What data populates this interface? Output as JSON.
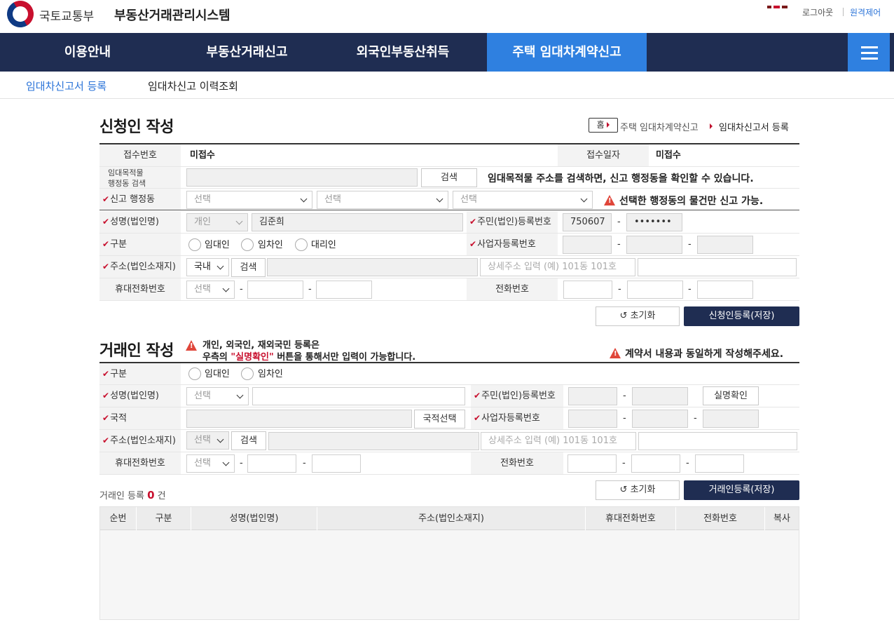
{
  "header": {
    "ministry": "국토교통부",
    "system_title": "부동산거래관리시스템",
    "logout": "로그아웃",
    "remote": "원격제어"
  },
  "nav": {
    "items": [
      {
        "label": "이용안내"
      },
      {
        "label": "부동산거래신고"
      },
      {
        "label": "외국인부동산취득"
      },
      {
        "label": "주택 임대차계약신고"
      }
    ]
  },
  "subnav": {
    "items": [
      {
        "label": "임대차신고서 등록"
      },
      {
        "label": "임대차신고 이력조회"
      }
    ]
  },
  "applicant": {
    "title": "신청인 작성",
    "breadcrumb": {
      "home": "홈",
      "level1": "주택 임대차계약신고",
      "current": "임대차신고서 등록"
    },
    "receipt_no_label": "접수번호",
    "receipt_no": "미접수",
    "receipt_date_label": "접수일자",
    "receipt_date": "미접수",
    "search_label": "임대목적물\n행정동 검색",
    "search_btn": "검색",
    "search_note": "임대목적물 주소를 검색하면, 신고 행정동을 확인할 수 있습니다.",
    "district_label": "신고 행정동",
    "district_sel1": "선택",
    "district_sel2": "선택",
    "district_sel3": "선택",
    "district_note": "선택한 행정동의 물건만 신고 가능.",
    "name_label": "성명(법인명)",
    "person_type": "개인",
    "name_value": "김준희",
    "rrn_label": "주민(법인)등록번호",
    "rrn_front": "750607",
    "rrn_back": "•••••••",
    "type_label": "구분",
    "type_options": [
      "임대인",
      "임차인",
      "대리인"
    ],
    "bizno_label": "사업자등록번호",
    "addr_label": "주소(법인소재지)",
    "addr_domestic": "국내",
    "addr_search": "검색",
    "addr_detail_placeholder": "상세주소 입력 (예) 101동 101호",
    "mobile_label": "휴대전화번호",
    "mobile_sel": "선택",
    "phone_label": "전화번호",
    "reset_btn": "초기화",
    "save_btn": "신청인등록(저장)"
  },
  "party": {
    "title": "거래인 작성",
    "note1": "개인, 외국인, 재외국민 등록은",
    "note2a": "우측의 ",
    "note2b": "\"실명확인\"",
    "note2c": " 버튼을 통해서만 입력이 가능합니다.",
    "note_right": "계약서 내용과 동일하게 작성해주세요.",
    "type_label": "구분",
    "type_options": [
      "임대인",
      "임차인"
    ],
    "name_label": "성명(법인명)",
    "name_sel": "선택",
    "rrn_label": "주민(법인)등록번호",
    "verify_btn": "실명확인",
    "nationality_label": "국적",
    "nationality_btn": "국적선택",
    "bizno_label": "사업자등록번호",
    "addr_label": "주소(법인소재지)",
    "addr_sel": "선택",
    "addr_search": "검색",
    "addr_detail_placeholder": "상세주소 입력 (예) 101동 101호",
    "mobile_label": "휴대전화번호",
    "mobile_sel": "선택",
    "phone_label": "전화번호",
    "reset_btn": "초기화",
    "save_btn": "거래인등록(저장)",
    "count_label": "거래인 등록",
    "count": "0",
    "count_unit": "건",
    "table_headers": [
      "순번",
      "구분",
      "성명(법인명)",
      "주소(법인소재지)",
      "휴대전화번호",
      "전화번호",
      "복사"
    ]
  },
  "colors": {
    "nav_bg": "#1f2d52",
    "nav_active": "#2f80e0",
    "primary_btn": "#1f2d52",
    "required": "#c8102e",
    "warning": "#e0463a"
  }
}
